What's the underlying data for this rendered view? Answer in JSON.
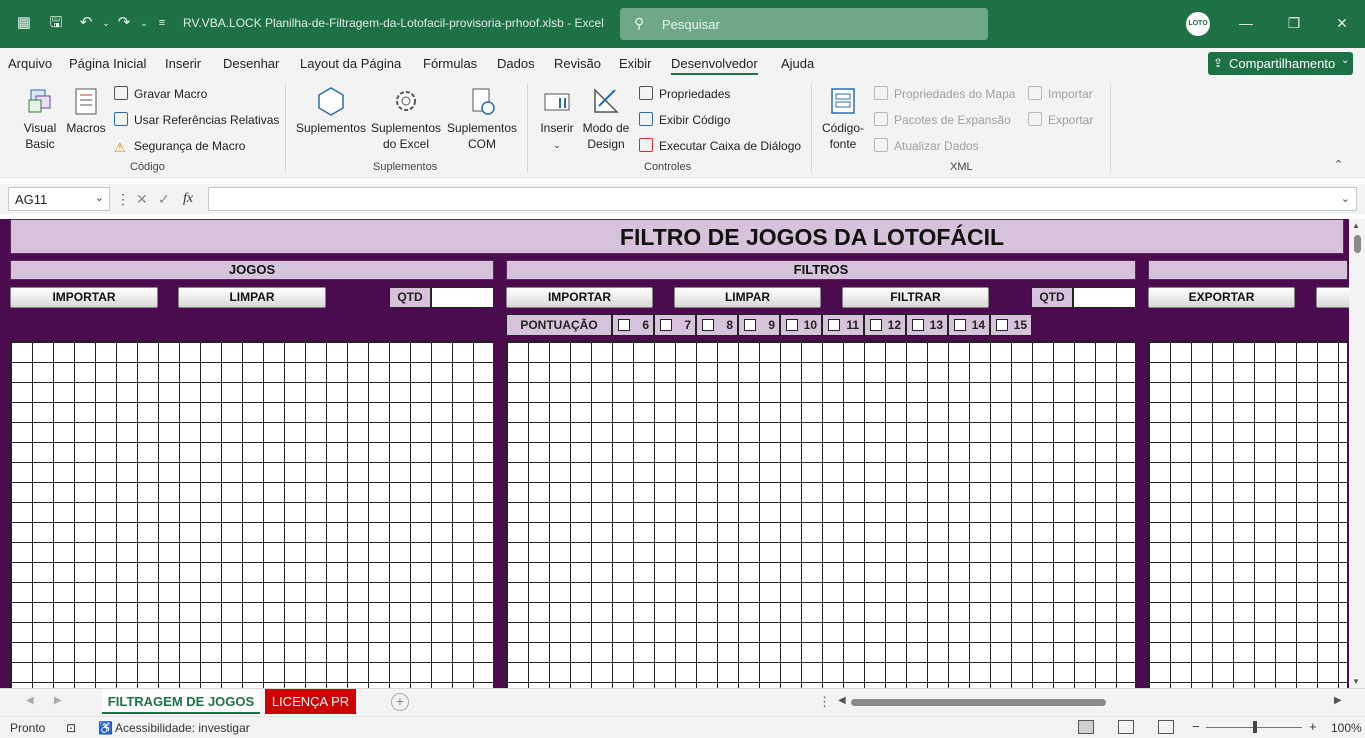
{
  "titlebar": {
    "title": "RV.VBA.LOCK Planilha-de-Filtragem-da-Lotofacil-provisoria-prhoof.xlsb  -  Excel",
    "search_placeholder": "Pesquisar",
    "avatar_text": "LOTO"
  },
  "menu": {
    "items": [
      "Arquivo",
      "Página Inicial",
      "Inserir",
      "Desenhar",
      "Layout da Página",
      "Fórmulas",
      "Dados",
      "Revisão",
      "Exibir",
      "Desenvolvedor",
      "Ajuda"
    ],
    "active": "Desenvolvedor",
    "share_label": "Compartilhamento"
  },
  "ribbon": {
    "codigo": {
      "group_label": "Código",
      "visual_basic": "Visual\nBasic",
      "macros": "Macros",
      "gravar_macro": "Gravar Macro",
      "usar_referencias": "Usar Referências Relativas",
      "seguranca_macro": "Segurança de Macro"
    },
    "suplementos": {
      "group_label": "Suplementos",
      "suplementos": "Suplementos",
      "suplementos_excel": "Suplementos\ndo Excel",
      "suplementos_com": "Suplementos\nCOM"
    },
    "controles": {
      "group_label": "Controles",
      "inserir": "Inserir",
      "modo_design": "Modo de\nDesign",
      "propriedades": "Propriedades",
      "exibir_codigo": "Exibir Código",
      "executar_caixa": "Executar Caixa de Diálogo"
    },
    "xml": {
      "group_label": "XML",
      "codigo_fonte": "Código-\nfonte",
      "propriedades_mapa": "Propriedades do Mapa",
      "pacotes_expansao": "Pacotes de Expansão",
      "atualizar_dados": "Atualizar Dados",
      "importar": "Importar",
      "exportar": "Exportar"
    }
  },
  "formula_bar": {
    "name_box": "AG11",
    "formula": ""
  },
  "sheet": {
    "title": "FILTRO DE JOGOS DA LOTOFÁCIL",
    "sections": {
      "jogos": "JOGOS",
      "filtros": "FILTROS"
    },
    "buttons": {
      "jogos_importar": "IMPORTAR",
      "jogos_limpar": "LIMPAR",
      "filtros_importar": "IMPORTAR",
      "filtros_limpar": "LIMPAR",
      "filtros_filtrar": "FILTRAR",
      "exportar": "EXPORTAR"
    },
    "qtd_label": "QTD",
    "pontuacao_label": "PONTUAÇÃO",
    "pontuacao_options": [
      "6",
      "7",
      "8",
      "9",
      "10",
      "11",
      "12",
      "13",
      "14",
      "15"
    ]
  },
  "tabs": {
    "active": "FILTRAGEM DE JOGOS",
    "second": "LICENÇA PR"
  },
  "status": {
    "ready": "Pronto",
    "accessibility": "Acessibilidade: investigar",
    "zoom": "100%"
  },
  "colors": {
    "excel_green": "#1e7145",
    "sheet_purple": "#4b0b4f",
    "band_lilac": "#d7c2dc",
    "tab_red": "#cc0000"
  }
}
